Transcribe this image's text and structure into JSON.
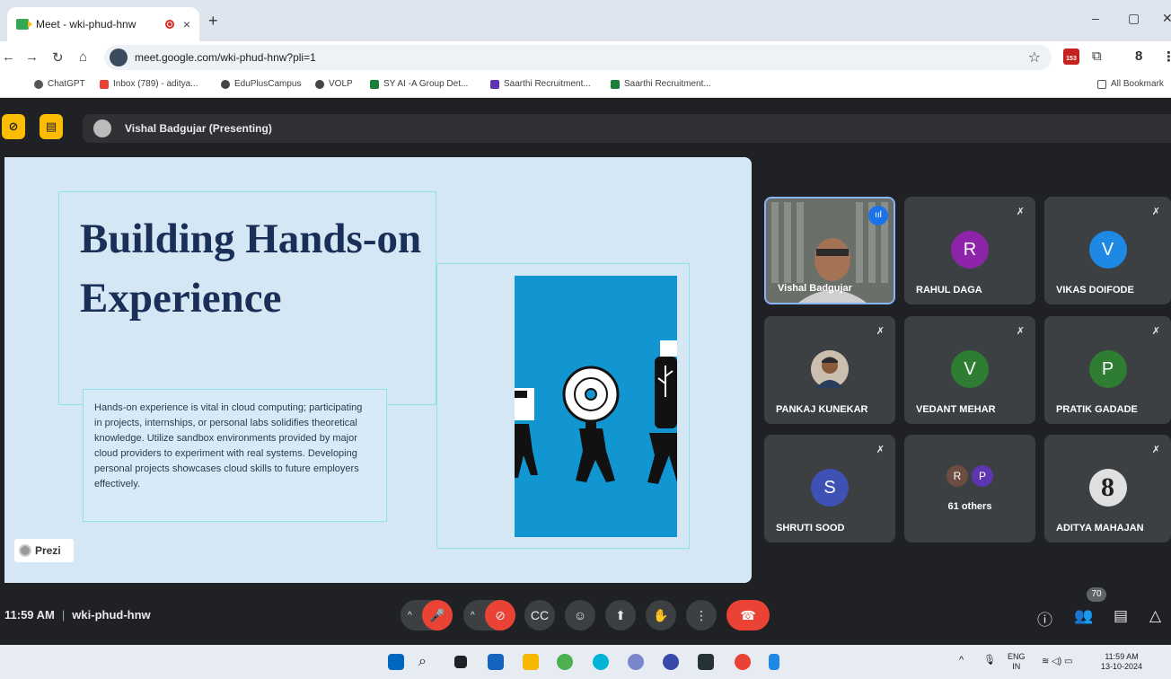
{
  "browser": {
    "tab_title": "Meet - wki-phud-hnw",
    "tab_close": "×",
    "new_tab": "+",
    "url": "meet.google.com/wki-phud-hnw?pli=1",
    "profile_initial": "8",
    "calendar_badge": "153",
    "bookmarks": [
      "ChatGPT",
      "Inbox (789) - aditya...",
      "EduPlusCampus",
      "VOLP",
      "SY AI -A Group Det...",
      "Saarthi Recruitment...",
      "Saarthi Recruitment..."
    ],
    "all_bookmarks": "All Bookmark"
  },
  "meet": {
    "presenting_label": "Vishal Badgujar (Presenting)",
    "slide": {
      "title": "Building Hands-on Experience",
      "paragraph": "Hands-on experience is vital in cloud computing; participating in projects, internships, or personal labs solidifies theoretical knowledge. Utilize sandbox environments provided by major cloud providers to experiment with real systems. Developing personal projects showcases cloud skills to future employers effectively.",
      "watermark": "Prezi"
    },
    "participants": [
      {
        "name": "Vishal Badgujar",
        "type": "video"
      },
      {
        "name": "RAHUL DAGA",
        "initial": "R",
        "color": "#8e24aa"
      },
      {
        "name": "VIKAS DOIFODE",
        "initial": "V",
        "color": "#1e88e5"
      },
      {
        "name": "PANKAJ KUNEKAR",
        "type": "photo"
      },
      {
        "name": "VEDANT MEHAR",
        "initial": "V",
        "color": "#2e7d32"
      },
      {
        "name": "PRATIK GADADE",
        "initial": "P",
        "color": "#2e7d32"
      },
      {
        "name": "SHRUTI SOOD",
        "initial": "S",
        "color": "#3f51b5"
      },
      {
        "name": "61 others",
        "initials": [
          "R",
          "P"
        ]
      },
      {
        "name": "ADITYA MAHAJAN",
        "initial": "8",
        "color": "#e0e0e0"
      }
    ],
    "time": "11:59 AM",
    "meeting_code": "wki-phud-hnw",
    "people_count": "70"
  },
  "taskbar": {
    "lang": "ENG",
    "region": "IN",
    "time": "11:59 AM",
    "date": "13-10-2024"
  }
}
